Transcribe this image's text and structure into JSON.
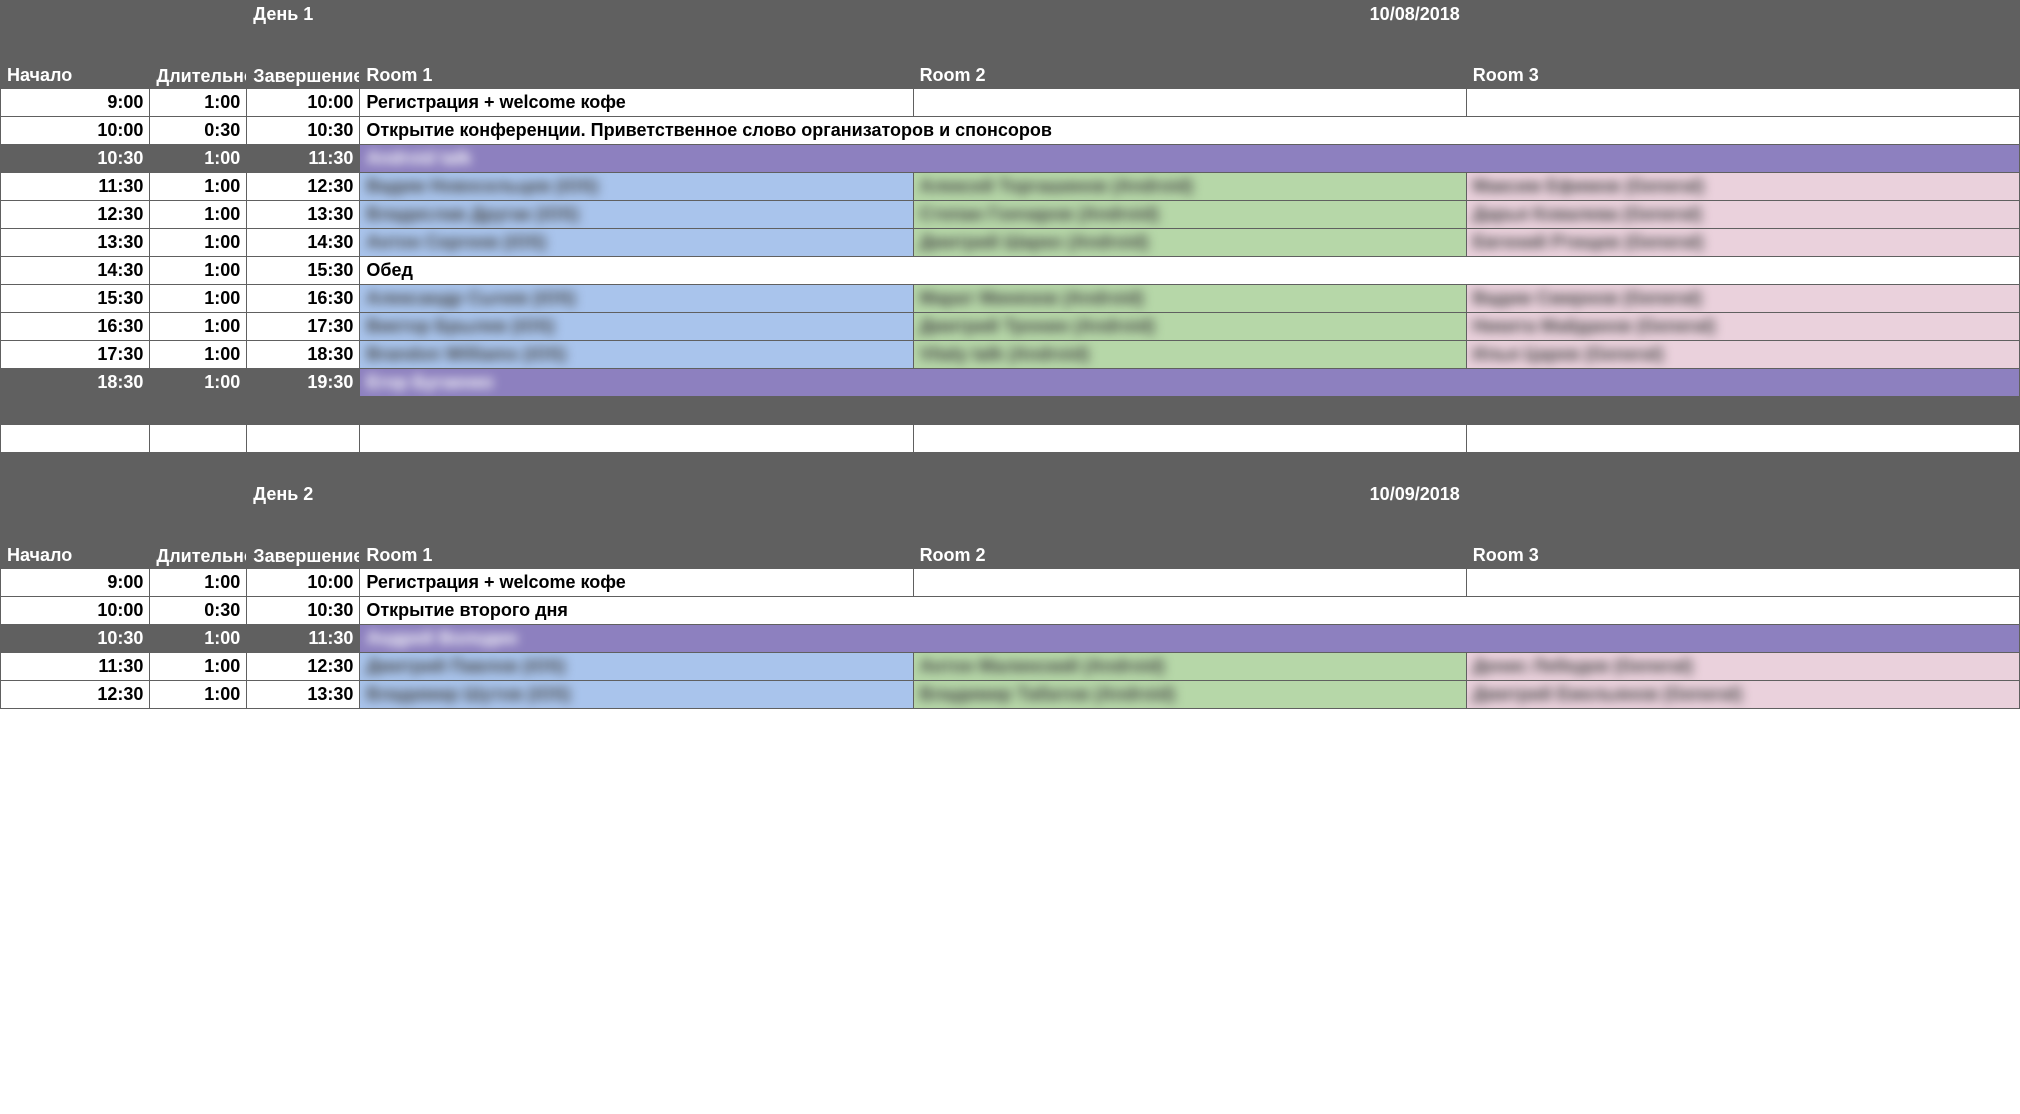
{
  "headers": {
    "start": "Начало",
    "duration": "Длительность",
    "end": "Завершение",
    "room1": "Room 1",
    "room2": "Room 2",
    "room3": "Room 3"
  },
  "day1": {
    "label": "День 1",
    "date": "10/08/2018",
    "rows": [
      {
        "start": "9:00",
        "dur": "1:00",
        "end": "10:00",
        "type": "white-span1",
        "room1": "Регистрация + welcome кофе",
        "room2": "",
        "room3": ""
      },
      {
        "start": "10:00",
        "dur": "0:30",
        "end": "10:30",
        "type": "white-span3",
        "room1": "Открытие конференции. Приветственное слово организаторов и спонсоров"
      },
      {
        "start": "10:30",
        "dur": "1:00",
        "end": "11:30",
        "type": "purple",
        "room1": "Android talk"
      },
      {
        "start": "11:30",
        "dur": "1:00",
        "end": "12:30",
        "type": "tri",
        "room1": "Вадим Новосельцев (iOS)",
        "room2": "Алексей Торгашинов (Android)",
        "room3": "Максим Ефимов (General)"
      },
      {
        "start": "12:30",
        "dur": "1:00",
        "end": "13:30",
        "type": "tri",
        "room1": "Владислав Другак (iOS)",
        "room2": "Степан Гончаров (Android)",
        "room3": "Дарья Ковалева (General)"
      },
      {
        "start": "13:30",
        "dur": "1:00",
        "end": "14:30",
        "type": "tri",
        "room1": "Антон Сергеев (iOS)",
        "room2": "Дмитрий Шарко (Android)",
        "room3": "Евгений Ртищев (General)"
      },
      {
        "start": "14:30",
        "dur": "1:00",
        "end": "15:30",
        "type": "white-span3",
        "room1": "Обед"
      },
      {
        "start": "15:30",
        "dur": "1:00",
        "end": "16:30",
        "type": "tri",
        "room1": "Александр Сычев (iOS)",
        "room2": "Марат Минязов (Android)",
        "room3": "Вадим Смирнов (General)"
      },
      {
        "start": "16:30",
        "dur": "1:00",
        "end": "17:30",
        "type": "tri",
        "room1": "Виктор Брылев (iOS)",
        "room2": "Дмитрий Тронин (Android)",
        "room3": "Никита Майданов (General)"
      },
      {
        "start": "17:30",
        "dur": "1:00",
        "end": "18:30",
        "type": "tri",
        "room1": "Brandon Williams (iOS)",
        "room2": "Vitaly talk (Android)",
        "room3": "Илья Царев (General)"
      },
      {
        "start": "18:30",
        "dur": "1:00",
        "end": "19:30",
        "type": "purple",
        "room1": "Егор Бугаенко"
      }
    ]
  },
  "day2": {
    "label": "День 2",
    "date": "10/09/2018",
    "rows": [
      {
        "start": "9:00",
        "dur": "1:00",
        "end": "10:00",
        "type": "white-span1",
        "room1": "Регистрация + welcome кофе",
        "room2": "",
        "room3": ""
      },
      {
        "start": "10:00",
        "dur": "0:30",
        "end": "10:30",
        "type": "white-span3",
        "room1": "Открытие второго дня"
      },
      {
        "start": "10:30",
        "dur": "1:00",
        "end": "11:30",
        "type": "purple",
        "room1": "Андрей Володин"
      },
      {
        "start": "11:30",
        "dur": "1:00",
        "end": "12:30",
        "type": "tri",
        "room1": "Дмитрий Павлов (iOS)",
        "room2": "Антон Малинский (Android)",
        "room3": "Денис Лебедев (General)"
      },
      {
        "start": "12:30",
        "dur": "1:00",
        "end": "13:30",
        "type": "tri",
        "room1": "Владимир Шутов (iOS)",
        "room2": "Владимир Табатов (Android)",
        "room3": "Дмитрий Емельянов (General)"
      }
    ]
  }
}
